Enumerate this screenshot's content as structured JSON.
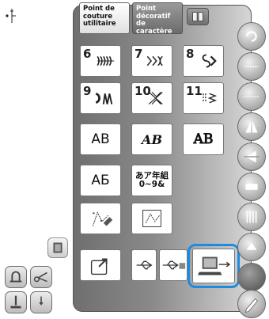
{
  "tabs": {
    "utility": "Point de\ncouture\nutilitaire",
    "character": "Point\ndécoratif\nde caractère"
  },
  "keys": {
    "k6": "6",
    "k7": "7",
    "k8": "8",
    "k9": "9",
    "k10": "10",
    "k11": "11",
    "font_gothic": "AB",
    "font_script": "AB",
    "font_outline": "AB",
    "font_cyrillic": "АБ",
    "font_japanese": "あア年組\n0~9&"
  },
  "colors": {
    "selection": "#1c8be0",
    "panel": "#8a8a8a"
  },
  "icons": [
    "needle-position-icon",
    "memory-pocket-icon",
    "thread-cutter-icon",
    "scissors-icon",
    "presser-foot-icon",
    "needle-down-icon",
    "book-icon",
    "back-icon",
    "auto-lock-icon",
    "sewing-stitch-icon",
    "mirror-icon",
    "direction-icon",
    "width-icon",
    "tension-icon",
    "presser-lift-icon",
    "pencil-icon",
    "retrieve-icon",
    "usb-icon",
    "usb-media-icon",
    "pc-usb-icon"
  ]
}
